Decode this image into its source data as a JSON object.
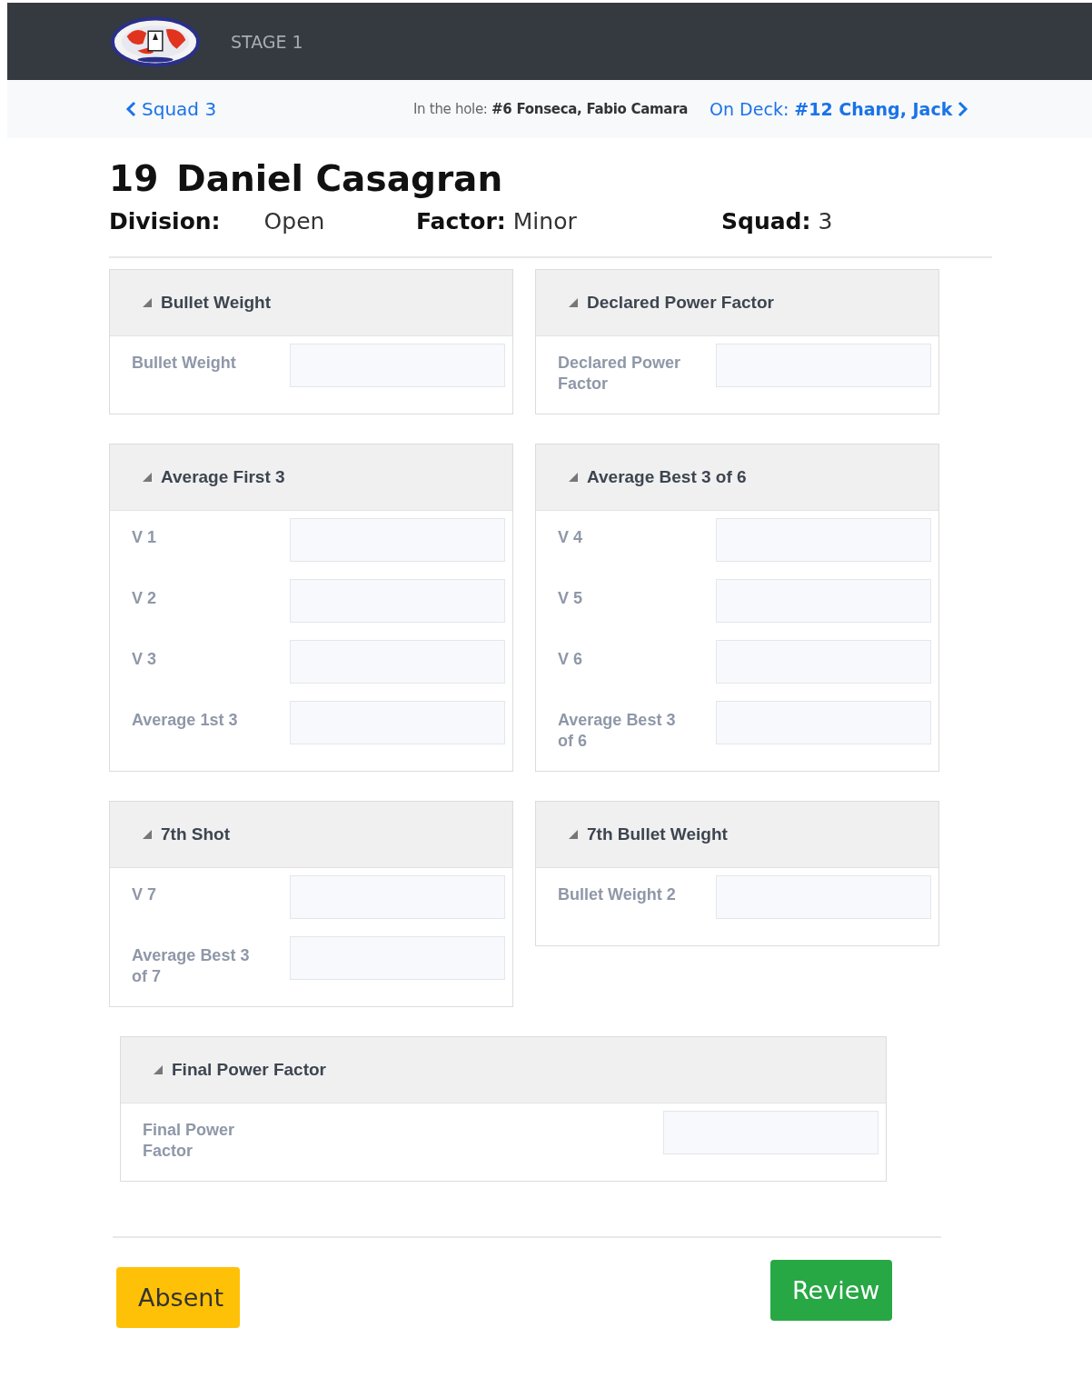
{
  "header": {
    "stage": "STAGE 1"
  },
  "nav": {
    "back": "Squad 3",
    "in_the_hole": "In the hole: **#6 Fonseca, Fabio Camara**",
    "on_deck": "On Deck: **#12 Chang, Jack**"
  },
  "competitor": {
    "number": "19",
    "name": "Daniel Casagran",
    "details": [
      {
        "label": "Division:",
        "value": "Open"
      },
      {
        "label": "Factor:",
        "value": "Minor"
      },
      {
        "label": "Squad:",
        "value": "3"
      }
    ]
  },
  "panels": [
    {
      "title": "Bullet Weight",
      "kind": "half",
      "expanded": true,
      "fields": [
        {
          "label": "Bullet Weight"
        }
      ]
    },
    {
      "title": "Declared Power Factor",
      "kind": "half",
      "expanded": true,
      "fields": [
        {
          "label": "Declared Power Factor"
        }
      ]
    },
    {
      "title": "Average First 3",
      "kind": "half",
      "expanded": true,
      "fields": [
        {
          "label": "V 1"
        },
        {
          "label": "V 2"
        },
        {
          "label": "V 3"
        },
        {
          "label": "Average 1st 3"
        }
      ]
    },
    {
      "title": "Average Best 3 of 6",
      "kind": "half",
      "expanded": true,
      "fields": [
        {
          "label": "V 4"
        },
        {
          "label": "V 5"
        },
        {
          "label": "V 6"
        },
        {
          "label": "Average Best 3 of 6"
        }
      ]
    },
    {
      "title": "7th Shot",
      "kind": "half",
      "expanded": true,
      "fields": [
        {
          "label": "V 7"
        },
        {
          "label": "Average Best 3 of 7"
        }
      ]
    },
    {
      "title": "7th Bullet Weight",
      "kind": "half",
      "expanded": true,
      "fields": [
        {
          "label": "Bullet Weight 2"
        }
      ]
    },
    {
      "title": "Final Power Factor",
      "kind": "full",
      "expanded": true,
      "fields": [
        {
          "label": "Final Power Factor"
        }
      ]
    }
  ],
  "buttons": [
    {
      "label": "Absent",
      "kind": "warning"
    },
    {
      "label": "Review",
      "kind": "success"
    }
  ]
}
